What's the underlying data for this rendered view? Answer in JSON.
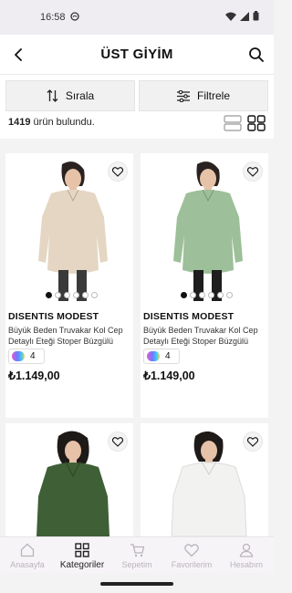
{
  "status_bar": {
    "time": "16:58"
  },
  "header": {
    "title": "ÜST GİYİM"
  },
  "controls": {
    "sort_label": "Sırala",
    "filter_label": "Filtrele"
  },
  "results": {
    "count": "1419",
    "suffix": " ürün bulundu."
  },
  "products": [
    {
      "brand": "DISENTIS MODEST",
      "description": "Büyük Beden Truvakar Kol Cep Detaylı Eteği Stoper Büzgülü Be...",
      "color_count": "4",
      "price": "₺1.149,00",
      "garment_color": "#e4d6c3"
    },
    {
      "brand": "DISENTIS MODEST",
      "description": "Büyük Beden Truvakar Kol Cep Detaylı Eteği Stoper Büzgülü Ça...",
      "color_count": "4",
      "price": "₺1.149,00",
      "garment_color": "#9dbf99"
    },
    {
      "garment_color": "#3f5f36"
    },
    {
      "garment_color": "#f2f2f0"
    }
  ],
  "bottom_nav": {
    "items": [
      {
        "label": "Anasayfa",
        "icon": "home-icon"
      },
      {
        "label": "Kategoriler",
        "icon": "grid-icon"
      },
      {
        "label": "Sepetim",
        "icon": "cart-icon"
      },
      {
        "label": "Favorilerim",
        "icon": "heart-icon"
      },
      {
        "label": "Hesabım",
        "icon": "user-icon"
      }
    ],
    "active": "Kategoriler"
  }
}
